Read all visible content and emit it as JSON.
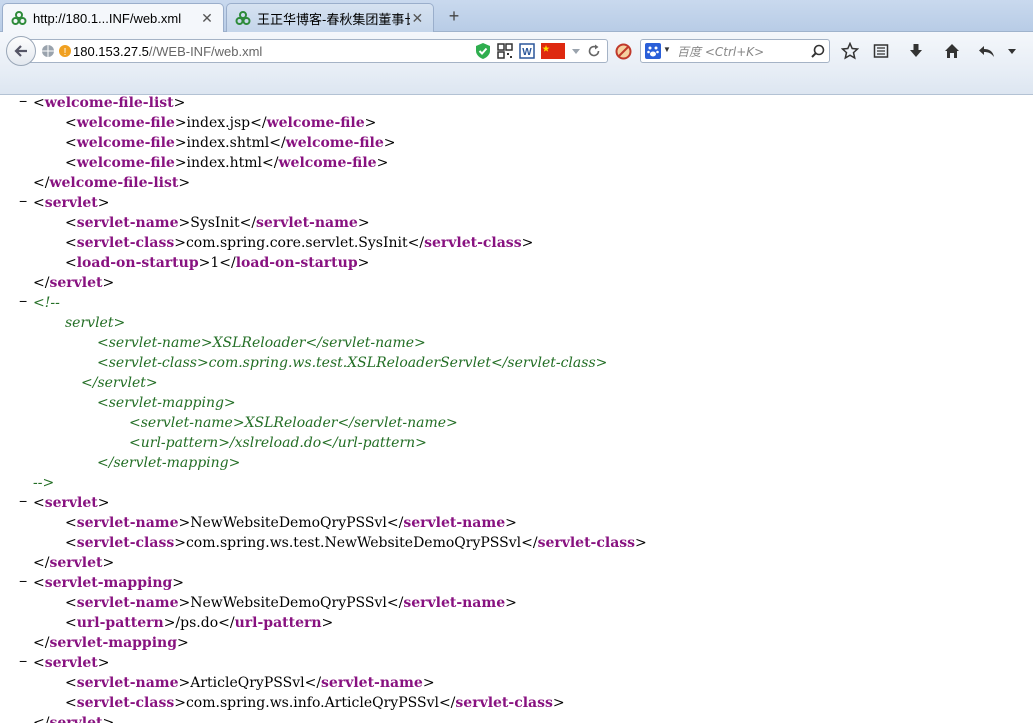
{
  "tabs": [
    {
      "title": "http://180.1...INF/web.xml",
      "active": true
    },
    {
      "title": "王正华博客-春秋集团董事长",
      "active": false
    }
  ],
  "new_tab_label": "+",
  "url": {
    "host": "180.153.27.5",
    "path": "//WEB-INF/web.xml"
  },
  "search": {
    "placeholder": "百度 <Ctrl+K>"
  },
  "colors": {
    "tag": "#881280",
    "comment": "#236e25",
    "chrome": "#c9d9ee"
  },
  "icons": [
    "back-arrow-icon",
    "globe-icon",
    "warning-icon",
    "shield-icon",
    "qr-icon",
    "word-icon",
    "china-flag-icon",
    "dropdown-icon",
    "reload-icon",
    "block-icon",
    "baidu-paw-icon",
    "search-icon",
    "star-icon",
    "reading-list-icon",
    "download-icon",
    "home-icon",
    "undo-icon",
    "menu-chevron-icon"
  ],
  "xml_lines": [
    {
      "indent": 0,
      "toggle": "−",
      "parts": [
        {
          "t": "tag",
          "open": "<",
          "name": "welcome-file-list",
          "close": ">"
        }
      ]
    },
    {
      "indent": 1,
      "parts": [
        {
          "t": "tag",
          "open": "<",
          "name": "welcome-file",
          "close": ">"
        },
        {
          "t": "text",
          "v": "index.jsp"
        },
        {
          "t": "tag",
          "open": "</",
          "name": "welcome-file",
          "close": ">"
        }
      ]
    },
    {
      "indent": 1,
      "parts": [
        {
          "t": "tag",
          "open": "<",
          "name": "welcome-file",
          "close": ">"
        },
        {
          "t": "text",
          "v": "index.shtml"
        },
        {
          "t": "tag",
          "open": "</",
          "name": "welcome-file",
          "close": ">"
        }
      ]
    },
    {
      "indent": 1,
      "parts": [
        {
          "t": "tag",
          "open": "<",
          "name": "welcome-file",
          "close": ">"
        },
        {
          "t": "text",
          "v": "index.html"
        },
        {
          "t": "tag",
          "open": "</",
          "name": "welcome-file",
          "close": ">"
        }
      ]
    },
    {
      "indent": 0,
      "parts": [
        {
          "t": "tag",
          "open": "</",
          "name": "welcome-file-list",
          "close": ">"
        }
      ]
    },
    {
      "indent": 0,
      "toggle": "−",
      "parts": [
        {
          "t": "tag",
          "open": "<",
          "name": "servlet",
          "close": ">"
        }
      ]
    },
    {
      "indent": 1,
      "parts": [
        {
          "t": "tag",
          "open": "<",
          "name": "servlet-name",
          "close": ">"
        },
        {
          "t": "text",
          "v": "SysInit"
        },
        {
          "t": "tag",
          "open": "</",
          "name": "servlet-name",
          "close": ">"
        }
      ]
    },
    {
      "indent": 1,
      "parts": [
        {
          "t": "tag",
          "open": "<",
          "name": "servlet-class",
          "close": ">"
        },
        {
          "t": "text",
          "v": "com.spring.core.servlet.SysInit"
        },
        {
          "t": "tag",
          "open": "</",
          "name": "servlet-class",
          "close": ">"
        }
      ]
    },
    {
      "indent": 1,
      "parts": [
        {
          "t": "tag",
          "open": "<",
          "name": "load-on-startup",
          "close": ">"
        },
        {
          "t": "text",
          "v": "1"
        },
        {
          "t": "tag",
          "open": "</",
          "name": "load-on-startup",
          "close": ">"
        }
      ]
    },
    {
      "indent": 0,
      "parts": [
        {
          "t": "tag",
          "open": "</",
          "name": "servlet",
          "close": ">"
        }
      ]
    },
    {
      "indent": 0,
      "toggle": "−",
      "parts": [
        {
          "t": "comment",
          "v": "<!--"
        }
      ]
    },
    {
      "indent": 1,
      "parts": [
        {
          "t": "comment",
          "v": "servlet>"
        }
      ]
    },
    {
      "indent": 2,
      "parts": [
        {
          "t": "comment",
          "v": "<servlet-name>XSLReloader</servlet-name>"
        }
      ]
    },
    {
      "indent": 2,
      "parts": [
        {
          "t": "comment",
          "v": "<servlet-class>com.spring.ws.test.XSLReloaderServlet</servlet-class>"
        }
      ]
    },
    {
      "indent": 1.5,
      "parts": [
        {
          "t": "comment",
          "v": "</servlet>"
        }
      ]
    },
    {
      "indent": 2,
      "parts": [
        {
          "t": "comment",
          "v": "<servlet-mapping>"
        }
      ]
    },
    {
      "indent": 3,
      "parts": [
        {
          "t": "comment",
          "v": "<servlet-name>XSLReloader</servlet-name>"
        }
      ]
    },
    {
      "indent": 3,
      "parts": [
        {
          "t": "comment",
          "v": "<url-pattern>/xslreload.do</url-pattern>"
        }
      ]
    },
    {
      "indent": 2,
      "parts": [
        {
          "t": "comment",
          "v": "</servlet-mapping>"
        }
      ]
    },
    {
      "indent": 0,
      "parts": [
        {
          "t": "comment",
          "v": "-->"
        }
      ]
    },
    {
      "indent": 0,
      "toggle": "−",
      "parts": [
        {
          "t": "tag",
          "open": "<",
          "name": "servlet",
          "close": ">"
        }
      ]
    },
    {
      "indent": 1,
      "parts": [
        {
          "t": "tag",
          "open": "<",
          "name": "servlet-name",
          "close": ">"
        },
        {
          "t": "text",
          "v": "NewWebsiteDemoQryPSSvl"
        },
        {
          "t": "tag",
          "open": "</",
          "name": "servlet-name",
          "close": ">"
        }
      ]
    },
    {
      "indent": 1,
      "parts": [
        {
          "t": "tag",
          "open": "<",
          "name": "servlet-class",
          "close": ">"
        },
        {
          "t": "text",
          "v": "com.spring.ws.test.NewWebsiteDemoQryPSSvl"
        },
        {
          "t": "tag",
          "open": "</",
          "name": "servlet-class",
          "close": ">"
        }
      ]
    },
    {
      "indent": 0,
      "parts": [
        {
          "t": "tag",
          "open": "</",
          "name": "servlet",
          "close": ">"
        }
      ]
    },
    {
      "indent": 0,
      "toggle": "−",
      "parts": [
        {
          "t": "tag",
          "open": "<",
          "name": "servlet-mapping",
          "close": ">"
        }
      ]
    },
    {
      "indent": 1,
      "parts": [
        {
          "t": "tag",
          "open": "<",
          "name": "servlet-name",
          "close": ">"
        },
        {
          "t": "text",
          "v": "NewWebsiteDemoQryPSSvl"
        },
        {
          "t": "tag",
          "open": "</",
          "name": "servlet-name",
          "close": ">"
        }
      ]
    },
    {
      "indent": 1,
      "parts": [
        {
          "t": "tag",
          "open": "<",
          "name": "url-pattern",
          "close": ">"
        },
        {
          "t": "text",
          "v": "/ps.do"
        },
        {
          "t": "tag",
          "open": "</",
          "name": "url-pattern",
          "close": ">"
        }
      ]
    },
    {
      "indent": 0,
      "parts": [
        {
          "t": "tag",
          "open": "</",
          "name": "servlet-mapping",
          "close": ">"
        }
      ]
    },
    {
      "indent": 0,
      "toggle": "−",
      "parts": [
        {
          "t": "tag",
          "open": "<",
          "name": "servlet",
          "close": ">"
        }
      ]
    },
    {
      "indent": 1,
      "parts": [
        {
          "t": "tag",
          "open": "<",
          "name": "servlet-name",
          "close": ">"
        },
        {
          "t": "text",
          "v": "ArticleQryPSSvl"
        },
        {
          "t": "tag",
          "open": "</",
          "name": "servlet-name",
          "close": ">"
        }
      ]
    },
    {
      "indent": 1,
      "parts": [
        {
          "t": "tag",
          "open": "<",
          "name": "servlet-class",
          "close": ">"
        },
        {
          "t": "text",
          "v": "com.spring.ws.info.ArticleQryPSSvl"
        },
        {
          "t": "tag",
          "open": "</",
          "name": "servlet-class",
          "close": ">"
        }
      ]
    },
    {
      "indent": 0,
      "parts": [
        {
          "t": "tag",
          "open": "</",
          "name": "servlet",
          "close": ">"
        }
      ]
    }
  ]
}
